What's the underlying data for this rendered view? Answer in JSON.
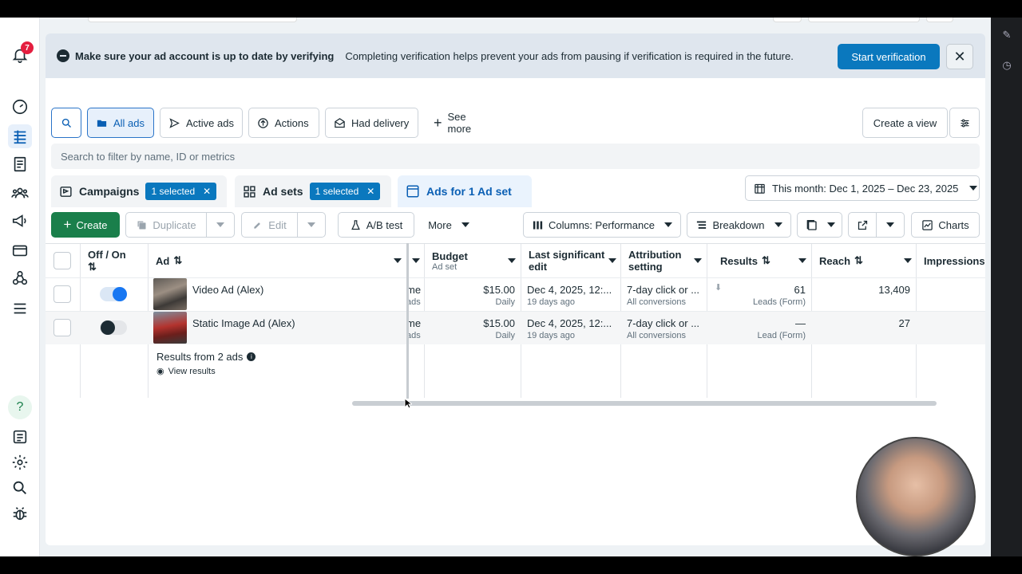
{
  "notifications": {
    "count": "7"
  },
  "banner": {
    "title": "Make sure your ad account is up to date by verifying",
    "message": "Completing verification helps prevent your ads from pausing if verification is required in the future.",
    "button": "Start verification",
    "close": "✕"
  },
  "filters": {
    "all_ads": "All ads",
    "active_ads": "Active ads",
    "actions": "Actions",
    "had_delivery": "Had delivery",
    "see_more": "See more",
    "create_view": "Create a view"
  },
  "search": {
    "placeholder": "Search to filter by name, ID or metrics"
  },
  "tabs": {
    "campaigns": "Campaigns",
    "campaigns_chip": "1 selected",
    "adsets": "Ad sets",
    "adsets_chip": "1 selected",
    "ads": "Ads for 1 Ad set"
  },
  "date_range": "This month: Dec 1, 2025 – Dec 23, 2025",
  "toolbar": {
    "create": "Create",
    "duplicate": "Duplicate",
    "edit": "Edit",
    "ab_test": "A/B test",
    "more": "More",
    "columns": "Columns: Performance",
    "breakdown": "Breakdown",
    "charts": "Charts"
  },
  "table": {
    "headers": {
      "off_on": "Off / On",
      "ad": "Ad",
      "budget": "Budget",
      "budget_sub": "Ad set",
      "last_change_1": "Last significant",
      "last_change_2": "edit",
      "attribution_1": "Attribution",
      "attribution_2": "setting",
      "results": "Results",
      "reach": "Reach",
      "impressions": "Impressions"
    },
    "rows": [
      {
        "name": "Video Ad (Alex)",
        "cut_top": "me",
        "cut_bottom": "ads",
        "budget": "$15.00",
        "budget_sub": "Daily",
        "edit": "Dec 4, 2025, 12:...",
        "edit_sub": "19 days ago",
        "attr": "7-day click or ...",
        "attr_sub": "All conversions",
        "results": "61",
        "results_sub": "Leads (Form)",
        "reach": "13,409",
        "on": true
      },
      {
        "name": "Static Image Ad (Alex)",
        "cut_top": "me",
        "cut_bottom": "ads",
        "budget": "$15.00",
        "budget_sub": "Daily",
        "edit": "Dec 4, 2025, 12:...",
        "edit_sub": "19 days ago",
        "attr": "7-day click or ...",
        "attr_sub": "All conversions",
        "results": "—",
        "results_sub": "Lead (Form)",
        "reach": "27",
        "on": false
      }
    ],
    "summary": "Results from 2 ads",
    "view_results": "View results"
  }
}
